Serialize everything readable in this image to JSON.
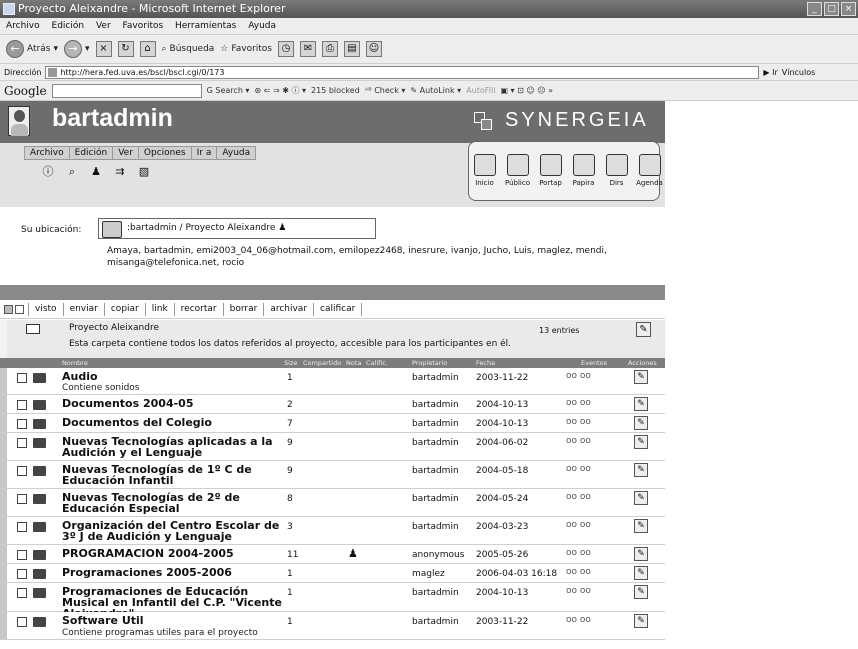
{
  "window": {
    "title": "Proyecto Aleixandre - Microsoft Internet Explorer"
  },
  "ie_menu": [
    "Archivo",
    "Edición",
    "Ver",
    "Favoritos",
    "Herramientas",
    "Ayuda"
  ],
  "ie_toolbar": {
    "back": "Atrás",
    "search": "Búsqueda",
    "favorites": "Favoritos"
  },
  "address": {
    "label": "Dirección",
    "url": "http://hera.fed.uva.es/bscl/bscl.cgi/0/173",
    "go": "Ir",
    "links": "Vínculos"
  },
  "google": {
    "logo": "Google",
    "search": "Search",
    "blocked": "215 blocked",
    "check": "Check",
    "autolink": "AutoLink",
    "autofill": "AutoFill"
  },
  "app": {
    "username": "bartadmin",
    "brand": "SYNERGEIA",
    "menu": [
      "Archivo",
      "Edición",
      "Ver",
      "Opciones",
      "Ir a",
      "Ayuda"
    ],
    "big_icons": [
      "Inicio",
      "Público",
      "Portap",
      "Papira",
      "Dirs",
      "Agenda"
    ]
  },
  "location": {
    "label": "Su ubicación:",
    "path": ":bartadmin / Proyecto Aleixandre",
    "participants": "Amaya, bartadmin, emi2003_04_06@hotmail.com, emilopez2468, inesrure, ivanjo, Jucho, Luis, maglez, mendi, misanga@telefonica.net, rocio"
  },
  "actions": [
    "visto",
    "enviar",
    "copiar",
    "link",
    "recortar",
    "borrar",
    "archivar",
    "calificar"
  ],
  "folder": {
    "title": "Proyecto Aleixandre",
    "description": "Esta carpeta contiene todos los datos referidos al proyecto, accesible para los participantes en él.",
    "count": "13 entries"
  },
  "columns": {
    "nombre": "Nombre",
    "size": "Size",
    "compartido": "Compartido",
    "nota": "Nota",
    "calific": "Calific.",
    "propietario": "Propietario",
    "fecha": "Fecha",
    "eventos": "Eventos",
    "acciones": "Acciones"
  },
  "rows": [
    {
      "name": "Audio",
      "desc": "Contiene sonidos",
      "size": "1",
      "owner": "bartadmin",
      "date": "2003-11-22",
      "events": "oo oo"
    },
    {
      "name": "Documentos 2004-05",
      "desc": "",
      "size": "2",
      "owner": "bartadmin",
      "date": "2004-10-13",
      "events": "oo oo"
    },
    {
      "name": "Documentos del Colegio",
      "desc": "",
      "size": "7",
      "owner": "bartadmin",
      "date": "2004-10-13",
      "events": "oo oo"
    },
    {
      "name": "Nuevas Tecnologías aplicadas a la Audición y el Lenguaje",
      "desc": "",
      "size": "9",
      "owner": "bartadmin",
      "date": "2004-06-02",
      "events": "oo oo"
    },
    {
      "name": "Nuevas Tecnologías de 1º C de Educación Infantil",
      "desc": "",
      "size": "9",
      "owner": "bartadmin",
      "date": "2004-05-18",
      "events": "oo oo"
    },
    {
      "name": "Nuevas Tecnologías de 2º de Educación Especial",
      "desc": "",
      "size": "8",
      "owner": "bartadmin",
      "date": "2004-05-24",
      "events": "oo oo"
    },
    {
      "name": "Organización del Centro Escolar de 3º J de Audición y Lenguaje",
      "desc": "",
      "size": "3",
      "owner": "bartadmin",
      "date": "2004-03-23",
      "events": "oo oo"
    },
    {
      "name": "PROGRAMACION 2004-2005",
      "desc": "",
      "size": "11",
      "owner": "anonymous",
      "date": "2005-05-26",
      "events": "oo oo"
    },
    {
      "name": "Programaciones 2005-2006",
      "desc": "",
      "size": "1",
      "owner": "maglez",
      "date": "2006-04-03 16:18",
      "events": "oo oo"
    },
    {
      "name": "Programaciones de Educación Musical en Infantil del C.P. \"Vicente Aleixandre\"",
      "desc": "",
      "size": "1",
      "owner": "bartadmin",
      "date": "2004-10-13",
      "events": "oo oo"
    },
    {
      "name": "Software Util",
      "desc": "Contiene programas utiles para el proyecto",
      "size": "1",
      "owner": "bartadmin",
      "date": "2003-11-22",
      "events": "oo oo"
    }
  ]
}
